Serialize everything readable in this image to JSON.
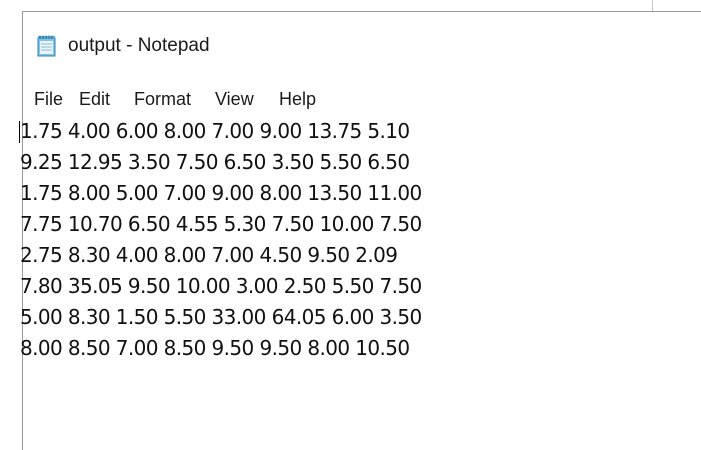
{
  "window": {
    "title": "output - Notepad",
    "icon": "notepad-icon"
  },
  "menu": {
    "items": [
      {
        "label": "File"
      },
      {
        "label": "Edit"
      },
      {
        "label": "Format"
      },
      {
        "label": "View"
      },
      {
        "label": "Help"
      }
    ]
  },
  "editor": {
    "lines": [
      "1.75 4.00 6.00 8.00 7.00 9.00 13.75 5.10",
      "9.25 12.95 3.50 7.50 6.50 3.50 5.50 6.50",
      "1.75 8.00 5.00 7.00 9.00 8.00 13.50 11.00",
      "7.75 10.70 6.50 4.55 5.30 7.50 10.00 7.50",
      "2.75 8.30 4.00 8.00 7.00 4.50 9.50 2.09",
      "7.80 35.05 9.50 10.00 3.00 2.50 5.50 7.50",
      "5.00 8.30 1.50 5.50 33.00 64.05 6.00 3.50",
      "8.00 8.50 7.00 8.50 9.50 9.50 8.00 10.50"
    ]
  }
}
